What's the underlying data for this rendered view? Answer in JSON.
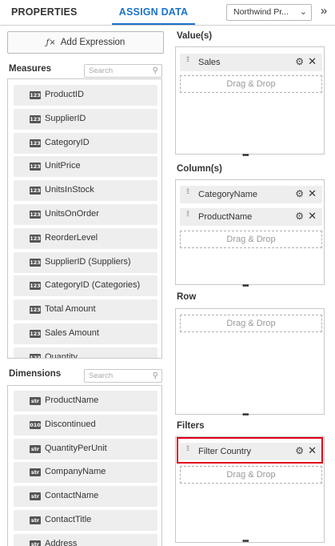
{
  "header": {
    "tab_properties": "PROPERTIES",
    "tab_assign_data": "ASSIGN DATA",
    "datasource": "Northwind Pr...",
    "collapse": "»"
  },
  "toolbar": {
    "add_expression": "Add Expression",
    "fx_symbol": "ƒ×"
  },
  "measures": {
    "title": "Measures",
    "search_placeholder": "Search",
    "items": [
      {
        "badge": "123",
        "label": "ProductID"
      },
      {
        "badge": "123",
        "label": "SupplierID"
      },
      {
        "badge": "123",
        "label": "CategoryID"
      },
      {
        "badge": "123",
        "label": "UnitPrice"
      },
      {
        "badge": "123",
        "label": "UnitsInStock"
      },
      {
        "badge": "123",
        "label": "UnitsOnOrder"
      },
      {
        "badge": "123",
        "label": "ReorderLevel"
      },
      {
        "badge": "123",
        "label": "SupplierID (Suppliers)"
      },
      {
        "badge": "123",
        "label": "CategoryID (Categories)"
      },
      {
        "badge": "123",
        "label": "Total Amount"
      },
      {
        "badge": "123",
        "label": "Sales Amount"
      },
      {
        "badge": "123",
        "label": "Quantity"
      }
    ]
  },
  "dimensions": {
    "title": "Dimensions",
    "search_placeholder": "Search",
    "items": [
      {
        "badge": "str",
        "label": "ProductName"
      },
      {
        "badge": "010",
        "label": "Discontinued"
      },
      {
        "badge": "str",
        "label": "QuantityPerUnit"
      },
      {
        "badge": "str",
        "label": "CompanyName"
      },
      {
        "badge": "str",
        "label": "ContactName"
      },
      {
        "badge": "str",
        "label": "ContactTitle"
      },
      {
        "badge": "str",
        "label": "Address"
      }
    ]
  },
  "values": {
    "title": "Value(s)",
    "chips": [
      "Sales"
    ],
    "drop_hint": "Drag & Drop"
  },
  "columns": {
    "title": "Column(s)",
    "chips": [
      "CategoryName",
      "ProductName"
    ],
    "drop_hint": "Drag & Drop"
  },
  "row": {
    "title": "Row",
    "drop_hint": "Drag & Drop"
  },
  "filters": {
    "title": "Filters",
    "chips": [
      "Filter Country"
    ],
    "drop_hint": "Drag & Drop"
  },
  "colors": {
    "accent": "#1a73c9",
    "highlight": "#e0001b"
  }
}
